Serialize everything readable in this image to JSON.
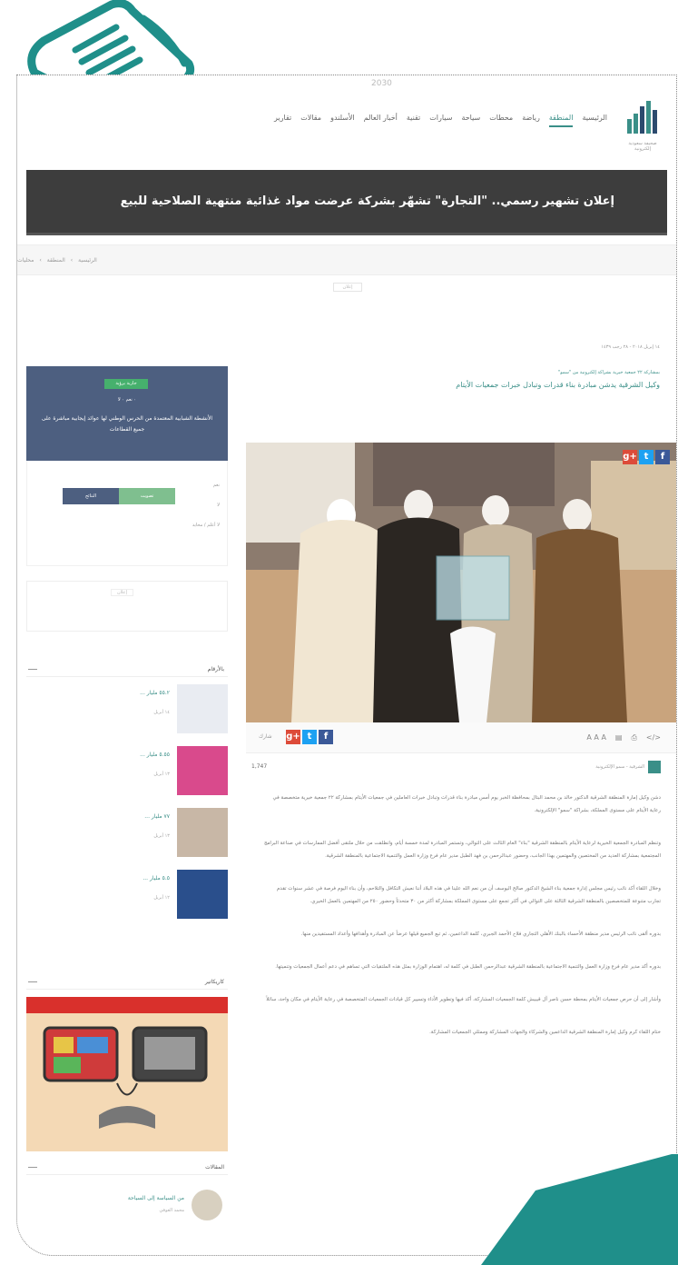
{
  "topbar": {
    "vision_text": "2030",
    "logo_caption": "صحيفة سعودية إلكترونية",
    "nav": [
      "الرئيسية",
      "المنطقة",
      "رياضة",
      "محطات",
      "سياحة",
      "سيارات",
      "تقنية",
      "أخبار العالم",
      "الأسلندو",
      "مقالات",
      "تقارير"
    ]
  },
  "headline": "إعلان تشهير رسمي.. \"التجارة\" تشهّر بشركة عرضت مواد غذائية منتهية الصلاحية للبيع",
  "breadcrumb": [
    "الرئيسية",
    "المنطقة",
    "محليات"
  ],
  "ad_label": "إعلان",
  "article": {
    "date": "١٤ إبريل ٢٠١٨ - ٢٨ رجب ١٤٣٩",
    "subtitle": "بمشاركة ٢٢ جمعية خيرية بشراكة إلكترونية من \"سمو\"",
    "title": "وكيل الشرقية يدشن مبادرة بناء قدرات وتبادل خبرات جمعيات الأيتام",
    "share_label": "شارك",
    "views": "1,747",
    "source": "الشرقية - سمو الإلكترونية",
    "paragraphs": [
      "دشن وكيل إمارة المنطقة الشرقية الدكتور خالد بن محمد البتال بمحافظة الخبر يوم أمس مبادرة بناء قدرات وتبادل خبرات العاملين في جمعيات الأيتام بمشاركة ٢٢ جمعية خيرية متخصصة في رعاية الأيتام على مستوى المملكة، بشراكة \"سمو\" الإلكترونية.",
      "وتنظم المبادرة الجمعية الخيرية لرعاية الأيتام بالمنطقة الشرقية \"بناء\" العام الثالث على التوالي، وتستمر المبادرة لمدة خمسة أيام، وانطلقت من خلال ملتقى أفضل الممارسات في صناعة البرامج المجتمعية بمشاركة العديد من المختصين والمهتمين بهذا الجانب، وحضور عبدالرحمن بن فهد الطبل مدير عام فرع وزارة العمل والتنمية الاجتماعية بالمنطقة الشرقية.",
      "وخلال اللقاء أكد نائب رئيس مجلس إدارة جمعية بناء الشيخ الدكتور صالح اليوسف أن من نعم الله علينا في هذه البلاد أننا نعيش التكافل والتلاحم، وأن بناء اليوم فرصة في عشر سنوات تقدم تجارب متنوعة للمتخصصين بالمنطقة الشرقية الثالثة على التوالي في أكثر تجمع على مستوى المملكة بمشاركة أكثر من ٣٠ متحدثاً وحضور ٢٥٠ من المهتمين بالعمل الخيري.",
      "بدوره ألقى نائب الرئيس مدير منطقة الأحساء بالبنك الأهلي التجاري فلاح الأحمد الجبري، كلمة الداعمين، ثم تبع الجميع قيلها عرضاً عن المبادرة وأهدافها وأعداد المستفيدين منها.",
      "بدوره أكد مدير عام فرع وزارة العمل والتنمية الاجتماعية بالمنطقة الشرقية عبدالرحمن الطبل في كلمة له، اهتمام الوزارة بمثل هذه الملتقيات التي تساهم في دعم أعمال الجمعيات وتنميتها.",
      "وأشار إلى أن حرص جمعيات الأيتام بمحطة حسن ناصر آل قيبيش كلمة الجمعيات المشاركة، أكد فيها وتطوير الأداء وتسيير كل قيادات الجمعيات المتخصصة في رعاية الأيتام في مكان واحد، سائلاً",
      "ختام اللقاء كرم وكيل إمارة المنطقة الشرقية الداعمين والشركاء والجهات المشاركة وممثلي الجمعيات المشاركة."
    ]
  },
  "sidebar": {
    "poll": {
      "badge": "جارية برؤية",
      "stats": "٠ نعم  ٠ لا",
      "question": "الأنشطة الشبابية المعتمدة من الحرس الوطني لها عوائد إيجابية مباشرة على جميع القطاعات",
      "options": [
        "نعم",
        "لا",
        "لا أعلم / محايد"
      ],
      "vote_label": "تصويت",
      "results_label": "النتائج"
    },
    "ad_label": "إعلان",
    "numbers_title": "بالأرقام",
    "numbers": [
      {
        "title": "٥٥.٢ مليار ...",
        "meta": "١٤ أبريل"
      },
      {
        "title": "٥.٥٥ مليار ...",
        "meta": "١٣ أبريل"
      },
      {
        "title": "٧٧ مليار ...",
        "meta": "١٣ أبريل"
      },
      {
        "title": "٥.٥ مليار ...",
        "meta": "١٢ أبريل"
      }
    ],
    "caricature_title": "كاريكاتير",
    "articles_title": "المقالات",
    "author": {
      "name": "من السياسة إلى السياحة",
      "sub": "محمد العوفي"
    }
  },
  "colors": {
    "accent": "#3a8f88",
    "headline_bg": "#3d3d3d",
    "poll_bg": "#4d5f80",
    "deco": "#1f8f8a"
  }
}
